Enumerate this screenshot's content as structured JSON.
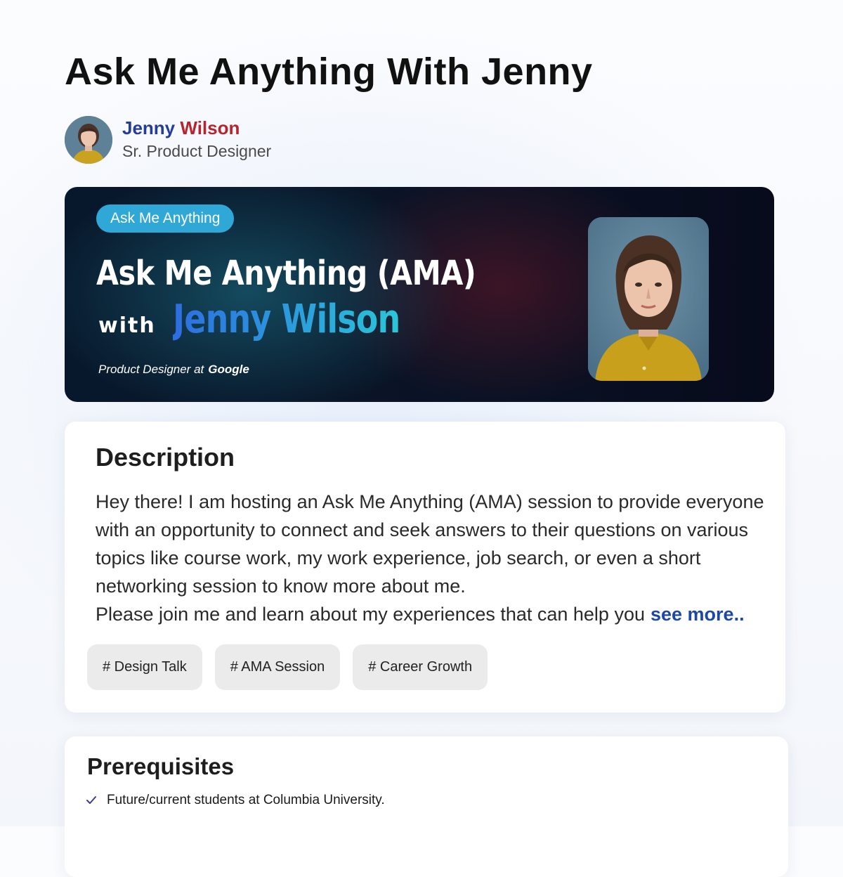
{
  "page": {
    "title": "Ask Me Anything With Jenny"
  },
  "author": {
    "first_name": "Jenny",
    "last_name": "Wilson",
    "role": "Sr. Product Designer"
  },
  "banner": {
    "badge": "Ask Me Anything",
    "title": "Ask Me Anything (AMA)",
    "with_word": "with",
    "host_name": "Jenny Wilson",
    "subtitle": "Product Designer  at",
    "company": "Google"
  },
  "description": {
    "heading": "Description",
    "paragraph_1": "Hey there! I am hosting an Ask Me Anything (AMA) session to provide everyone with an opportunity to connect and seek answers to their questions on various topics like course work, my work experience, job search, or even a short networking session to know more about me.",
    "paragraph_2": "Please join me and learn about my experiences that can help you",
    "see_more": "see more.."
  },
  "tags": [
    "# Design Talk",
    "# AMA Session",
    "# Career Growth"
  ],
  "prerequisites": {
    "heading": "Prerequisites",
    "items": [
      "Future/current students at Columbia University."
    ]
  },
  "colors": {
    "badge": "#2fa8d8",
    "link": "#1e48a8",
    "name_first": "#243c9c",
    "name_last": "#b8242e",
    "check": "#3b3e8c"
  },
  "icons": [
    "avatar-portrait",
    "check-icon"
  ]
}
